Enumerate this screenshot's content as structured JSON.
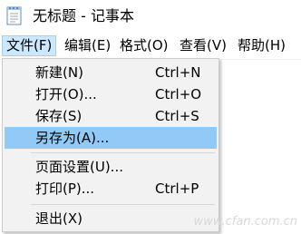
{
  "window": {
    "title": "无标题 - 记事本",
    "icon": "notepad-icon"
  },
  "menubar": {
    "items": [
      {
        "label": "文件(F)",
        "active": true
      },
      {
        "label": "编辑(E)",
        "active": false
      },
      {
        "label": "格式(O)",
        "active": false
      },
      {
        "label": "查看(V)",
        "active": false
      },
      {
        "label": "帮助(H)",
        "active": false
      }
    ]
  },
  "file_menu": {
    "items": [
      {
        "label": "新建(N)",
        "shortcut": "Ctrl+N"
      },
      {
        "label": "打开(O)...",
        "shortcut": "Ctrl+O"
      },
      {
        "label": "保存(S)",
        "shortcut": "Ctrl+S"
      },
      {
        "label": "另存为(A)...",
        "shortcut": "",
        "highlighted": true
      },
      {
        "label": "页面设置(U)...",
        "shortcut": ""
      },
      {
        "label": "打印(P)...",
        "shortcut": "Ctrl+P"
      },
      {
        "label": "退出(X)",
        "shortcut": ""
      }
    ]
  },
  "watermark": "www.cfan.com.cn",
  "colors": {
    "menubar_active_bg": "#cce8ff",
    "menu_highlight_bg": "#91c9f7",
    "menu_bg": "#f2f2f2"
  }
}
